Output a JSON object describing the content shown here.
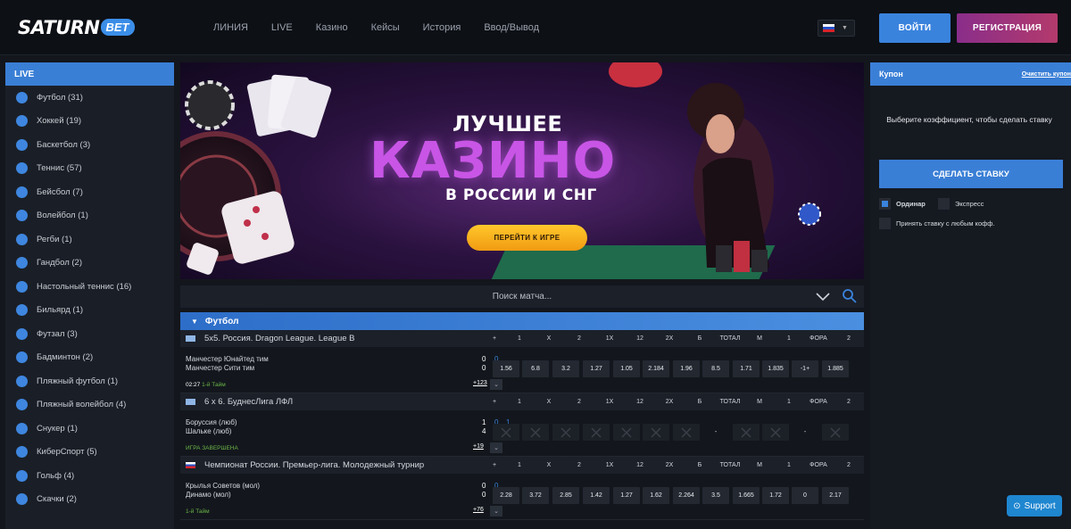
{
  "brand": {
    "main": "SATURN",
    "badge": "BET"
  },
  "nav": [
    "ЛИНИЯ",
    "LIVE",
    "Казино",
    "Кейсы",
    "История",
    "Ввод/Вывод"
  ],
  "auth": {
    "login": "ВОЙТИ",
    "register": "РЕГИСТРАЦИЯ"
  },
  "sidebar": {
    "title": "LIVE",
    "items": [
      {
        "label": "Футбол (31)",
        "icon": "soccer-ball-icon"
      },
      {
        "label": "Хоккей (19)",
        "icon": "hockey-sticks-icon"
      },
      {
        "label": "Баскетбол (3)",
        "icon": "basketball-icon"
      },
      {
        "label": "Теннис (57)",
        "icon": "tennis-racket-icon"
      },
      {
        "label": "Бейсбол (7)",
        "icon": "baseball-player-icon"
      },
      {
        "label": "Волейбол (1)",
        "icon": "volleyball-icon"
      },
      {
        "label": "Регби (1)",
        "icon": "rugby-ball-icon"
      },
      {
        "label": "Гандбол (2)",
        "icon": "handball-player-icon"
      },
      {
        "label": "Настольный теннис (16)",
        "icon": "table-tennis-icon"
      },
      {
        "label": "Бильярд (1)",
        "icon": "billiards-icon"
      },
      {
        "label": "Футзал (3)",
        "icon": "futsal-ball-icon"
      },
      {
        "label": "Бадминтон (2)",
        "icon": "shuttlecock-icon"
      },
      {
        "label": "Пляжный футбол (1)",
        "icon": "beach-soccer-icon"
      },
      {
        "label": "Пляжный волейбол (4)",
        "icon": "beach-volleyball-icon"
      },
      {
        "label": "Снукер (1)",
        "icon": "snooker-icon"
      },
      {
        "label": "КиберСпорт (5)",
        "icon": "trophy-icon"
      },
      {
        "label": "Гольф (4)",
        "icon": "golf-icon"
      },
      {
        "label": "Скачки (2)",
        "icon": "horse-racing-icon"
      }
    ]
  },
  "banner": {
    "line1": "ЛУЧШЕЕ",
    "line2": "КАЗИНО",
    "line3": "В РОССИИ И СНГ",
    "button": "ПЕРЕЙТИ К ИГРЕ"
  },
  "search": {
    "placeholder": "Поиск матча..."
  },
  "events": {
    "sport": "Футбол",
    "columns": [
      "+",
      "1",
      "X",
      "2",
      "1X",
      "12",
      "2X",
      "Б",
      "ТОТАЛ",
      "М",
      "1",
      "ФОРА",
      "2"
    ],
    "leagues": [
      {
        "name": "5х5. Россия. Dragon League. League B",
        "flag": "generic",
        "home": "Манчестер Юнайтед тим",
        "away": "Манчестер Сити тим",
        "home_score": [
          "0",
          "0"
        ],
        "away_score": [
          "0",
          "0"
        ],
        "odds": [
          "1.56",
          "6.8",
          "3.2",
          "1.27",
          "1.05",
          "2.184",
          "1.96",
          "8.5",
          "1.71",
          "1.835",
          "-1+",
          "1.885"
        ],
        "time": "02:27",
        "period": "1-й Тайм",
        "more": "+123"
      },
      {
        "name": "6 х 6. БуднесЛига ЛФЛ",
        "flag": "generic",
        "home": "Боруссия (люб)",
        "away": "Шальке (люб)",
        "home_score": [
          "1",
          "0",
          "1"
        ],
        "away_score": [
          "4",
          "3",
          "1"
        ],
        "odds": [
          "locked",
          "locked",
          "locked",
          "locked",
          "locked",
          "locked",
          "locked",
          "-",
          "locked",
          "locked",
          "-",
          "locked"
        ],
        "time": "",
        "period": "ИГРА ЗАВЕРШЕНА",
        "more": "+19"
      },
      {
        "name": "Чемпионат России. Премьер-лига. Молодежный турнир",
        "flag": "russia",
        "home": "Крылья Советов (мол)",
        "away": "Динамо (мол)",
        "home_score": [
          "0",
          "0"
        ],
        "away_score": [
          "0",
          "0"
        ],
        "odds": [
          "2.28",
          "3.72",
          "2.85",
          "1.42",
          "1.27",
          "1.62",
          "2.264",
          "3.5",
          "1.665",
          "1.72",
          "0",
          "2.17"
        ],
        "time": "",
        "period": "1-й Тайм",
        "more": "+76"
      }
    ]
  },
  "coupon": {
    "title": "Купон",
    "clear": "Очистить купон",
    "hint": "Выберите коэффициент, чтобы сделать ставку",
    "make_bet": "СДЕЛАТЬ СТАВКУ",
    "single": "Ординар",
    "express": "Экспресс",
    "accept_any": "Принять ставку с любым кофф."
  },
  "support": "Support",
  "colors": {
    "accent": "#3a7fd6",
    "register": "#a0357b",
    "live_green": "#6bb547",
    "promo": "#f5a81a"
  }
}
